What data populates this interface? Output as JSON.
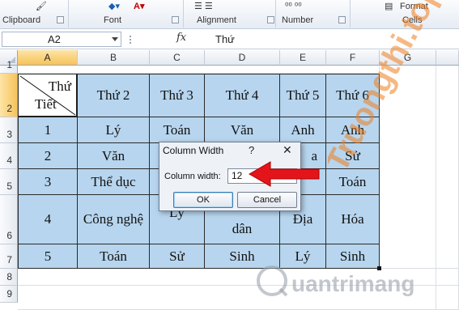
{
  "ribbon": {
    "groups": [
      "Clipboard",
      "Font",
      "Alignment",
      "Number",
      "Cells"
    ],
    "format_label": "Format"
  },
  "formula_bar": {
    "name_box": "A2",
    "fx_symbol": "fx",
    "content": "Thứ"
  },
  "sheet": {
    "columns": [
      "A",
      "B",
      "C",
      "D",
      "E",
      "F",
      "G"
    ],
    "active_column": "A",
    "rows": [
      "1",
      "2",
      "3",
      "4",
      "5",
      "6",
      "7",
      "8",
      "9"
    ],
    "active_row": "2",
    "a2_top": "Thứ",
    "a2_bottom": "Tiết",
    "header": [
      "Thứ 2",
      "Thứ 3",
      "Thứ 4",
      "Thứ 5",
      "Thứ 6"
    ],
    "body": [
      [
        "1",
        "Lý",
        "Toán",
        "Văn",
        "Anh",
        "Anh"
      ],
      [
        "2",
        "Văn",
        "",
        "",
        "a",
        "Sử"
      ],
      [
        "3",
        "Thể dục",
        "",
        "",
        "",
        "Toán"
      ],
      [
        "4",
        "Công nghệ",
        "Lý",
        "dân",
        "Địa",
        "Hóa"
      ],
      [
        "5",
        "Toán",
        "Sử",
        "Sinh",
        "Lý",
        "Sinh"
      ]
    ]
  },
  "dialog": {
    "title": "Column Width",
    "help": "?",
    "close": "✕",
    "label": "Column width:",
    "value": "12",
    "ok": "OK",
    "cancel": "Cancel"
  },
  "watermark": {
    "top_text": "Truongthi.top",
    "bottom_text": "uantrimang"
  },
  "colors": {
    "table_fill": "#b7d5ee",
    "active_header": "#f6c35a",
    "arrow": "#e4141b"
  }
}
